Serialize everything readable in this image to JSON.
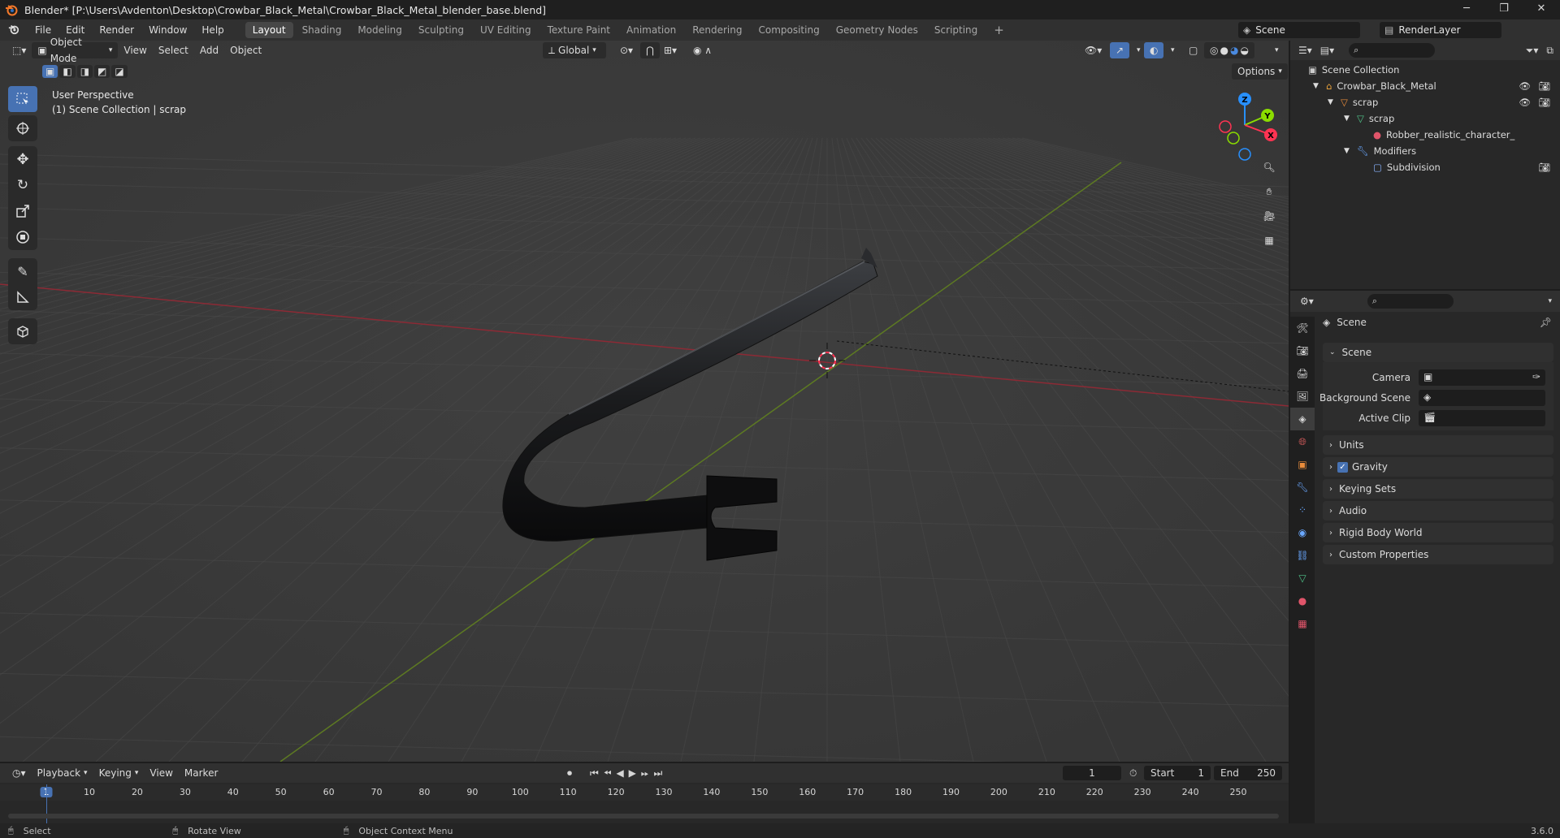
{
  "titlebar": {
    "title": "Blender* [P:\\Users\\Avdenton\\Desktop\\Crowbar_Black_Metal\\Crowbar_Black_Metal_blender_base.blend]",
    "minimize": "─",
    "maximize": "❐",
    "close": "✕"
  },
  "menu": {
    "items": [
      "File",
      "Edit",
      "Render",
      "Window",
      "Help"
    ],
    "workspaces": [
      "Layout",
      "Shading",
      "Modeling",
      "Sculpting",
      "UV Editing",
      "Texture Paint",
      "Animation",
      "Rendering",
      "Compositing",
      "Geometry Nodes",
      "Scripting"
    ],
    "add_workspace": "+",
    "scene": "Scene",
    "view_layer": "RenderLayer"
  },
  "viewport": {
    "mode": "Object Mode",
    "menus": [
      "View",
      "Select",
      "Add",
      "Object"
    ],
    "orientation": "Global",
    "options": "Options",
    "view_name": "User Perspective",
    "collection_info": "(1) Scene Collection | scrap",
    "gizmo_axes": {
      "x": "X",
      "y": "Y",
      "z": "Z"
    }
  },
  "outliner": {
    "root": "Scene Collection",
    "rows": [
      {
        "label": "Crowbar_Black_Metal"
      },
      {
        "label": "scrap"
      },
      {
        "label": "scrap"
      },
      {
        "label": "Robber_realistic_character_"
      },
      {
        "label": "Modifiers"
      },
      {
        "label": "Subdivision"
      }
    ]
  },
  "properties": {
    "context": "Scene",
    "panel_title": "Scene",
    "fields": [
      {
        "label": "Camera"
      },
      {
        "label": "Background Scene"
      },
      {
        "label": "Active Clip"
      }
    ],
    "subpanels": [
      "Units",
      "Gravity",
      "Keying Sets",
      "Audio",
      "Rigid Body World",
      "Custom Properties"
    ],
    "gravity_checked": true
  },
  "timeline": {
    "menus": [
      "Playback",
      "Keying",
      "View",
      "Marker"
    ],
    "current_frame": "1",
    "start_label": "Start",
    "start": "1",
    "end_label": "End",
    "end": "250",
    "ruler": [
      "1",
      "10",
      "20",
      "30",
      "40",
      "50",
      "60",
      "70",
      "80",
      "90",
      "100",
      "110",
      "120",
      "130",
      "140",
      "150",
      "160",
      "170",
      "180",
      "190",
      "200",
      "210",
      "220",
      "230",
      "240",
      "250"
    ]
  },
  "statusbar": {
    "select": "Select",
    "rotate": "Rotate View",
    "context": "Object Context Menu",
    "version": "3.6.0"
  },
  "colors": {
    "accent": "#4772b3",
    "x_axis": "#ff3352",
    "y_axis": "#8bdc00",
    "z_axis": "#2890ff",
    "origin": "#ffaa40"
  }
}
